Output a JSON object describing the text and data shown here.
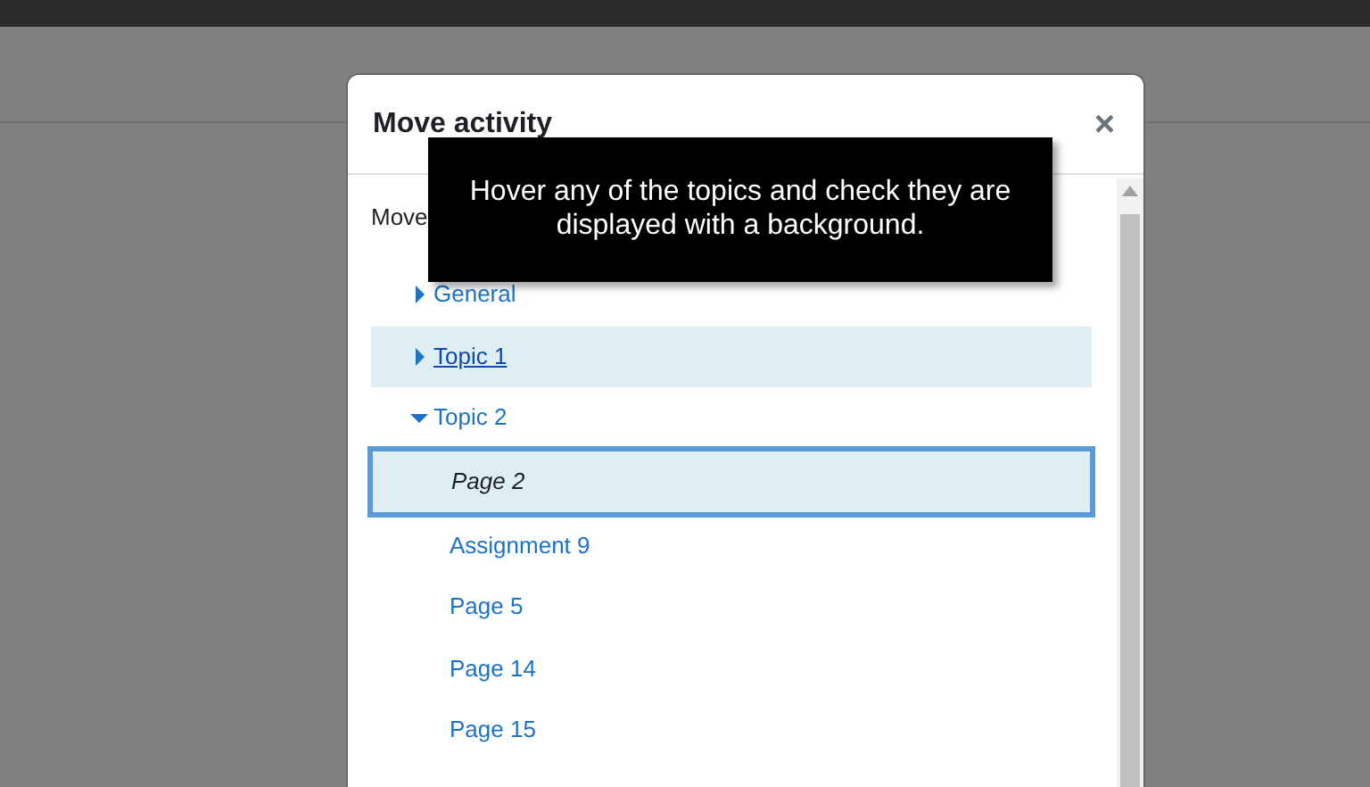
{
  "dialog": {
    "title": "Move activity",
    "close": "×",
    "intro": "Move",
    "tree": [
      {
        "kind": "section",
        "label": "General",
        "expanded": false,
        "hovered": false,
        "selected": false
      },
      {
        "kind": "section",
        "label": "Topic 1",
        "expanded": false,
        "hovered": true,
        "selected": false
      },
      {
        "kind": "section",
        "label": "Topic 2",
        "expanded": true,
        "hovered": false,
        "selected": false,
        "children": [
          {
            "kind": "activity",
            "label": "Page 2",
            "hovered": false,
            "selected": true
          },
          {
            "kind": "activity",
            "label": "Assignment 9",
            "hovered": false,
            "selected": false
          },
          {
            "kind": "activity",
            "label": "Page 5",
            "hovered": false,
            "selected": false
          },
          {
            "kind": "activity",
            "label": "Page 14",
            "hovered": false,
            "selected": false
          },
          {
            "kind": "activity",
            "label": "Page 15",
            "hovered": false,
            "selected": false
          }
        ]
      }
    ]
  },
  "tooltip": {
    "text": "Hover any of the topics and check they are displayed with a background."
  }
}
